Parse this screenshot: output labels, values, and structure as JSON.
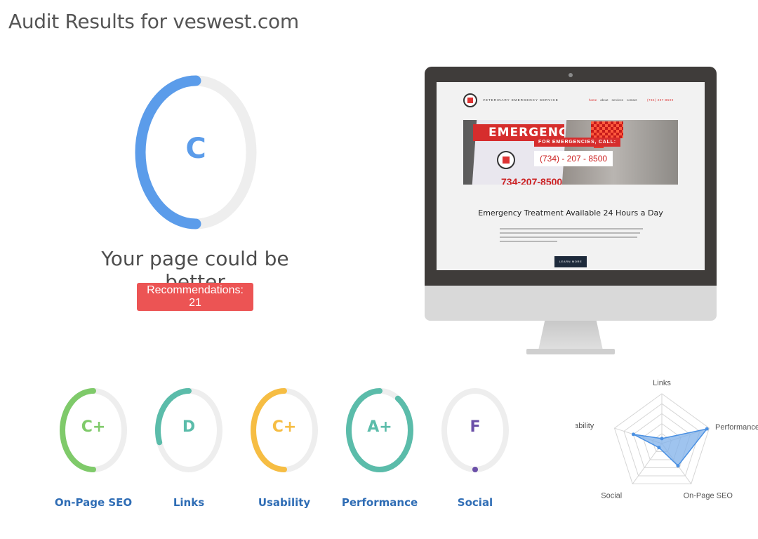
{
  "page": {
    "title": "Audit Results for veswest.com"
  },
  "overall": {
    "grade": "C",
    "verdict": "Your page could be better",
    "recommendations_label": "Recommendations: 21",
    "score_fraction": 0.5,
    "color": "#5b9cea"
  },
  "preview": {
    "site_name": "VETERINARY EMERGENCY SERVICE",
    "nav": [
      "home",
      "about",
      "services",
      "contact"
    ],
    "phone_header": "(734) 207-8500",
    "hero_banner": "EMERGENCY",
    "hero_sign_number": "734-207-8500",
    "cta_label": "FOR EMERGENCIES, CALL:",
    "cta_phone": "(734) - 207 - 8500",
    "headline": "Emergency Treatment Available 24 Hours a Day",
    "button": "LEARN MORE"
  },
  "categories": [
    {
      "name": "On-Page SEO",
      "grade": "C+",
      "fraction": 0.5,
      "color": "#7fca6a",
      "text_color": "#7fca6a"
    },
    {
      "name": "Links",
      "grade": "D",
      "fraction": 0.3,
      "color": "#5bbcaa",
      "text_color": "#5bbcaa"
    },
    {
      "name": "Usability",
      "grade": "C+",
      "fraction": 0.5,
      "color": "#f6bd43",
      "text_color": "#f6bd43"
    },
    {
      "name": "Performance",
      "grade": "A+",
      "fraction": 0.9,
      "color": "#5bbcaa",
      "text_color": "#5bbcaa"
    },
    {
      "name": "Social",
      "grade": "F",
      "fraction": 0.0,
      "color": "#6b4fa8",
      "text_color": "#6b4fa8"
    }
  ],
  "radar": {
    "axes": [
      "Links",
      "Performance",
      "On-Page SEO",
      "Social",
      "Usability"
    ],
    "values": [
      0.1,
      0.95,
      0.55,
      0.1,
      0.6
    ],
    "max": 1,
    "fill_color": "#7fb0ea",
    "stroke_color": "#4a90e2"
  }
}
